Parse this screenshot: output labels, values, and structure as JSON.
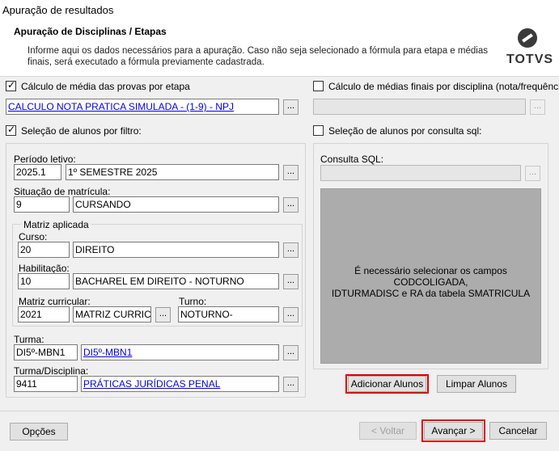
{
  "window": {
    "title": "Apuração de resultados"
  },
  "header": {
    "title": "Apuração de Disciplinas / Etapas",
    "description": "Informe aqui os dados necessários para a apuração. Caso não seja selecionado a fórmula para etapa e médias finais, será executado a fórmula previamente cadastrada.",
    "logo_text": "TOTVS"
  },
  "left": {
    "calc_media_label": "Cálculo de média das provas por etapa",
    "calc_media_checked": true,
    "formula_link": "CALCULO NOTA PRATICA SIMULADA - (1-9) - NPJ",
    "selecao_filtro_label": "Seleção de alunos por filtro:",
    "selecao_filtro_checked": true,
    "periodo_label": "Período letivo:",
    "periodo_code": "2025.1",
    "periodo_desc": "1º SEMESTRE 2025",
    "situacao_label": "Situação de matrícula:",
    "situacao_code": "9",
    "situacao_desc": "CURSANDO",
    "matriz_group_label": "Matriz aplicada",
    "curso_label": "Curso:",
    "curso_code": "20",
    "curso_desc": "DIREITO",
    "habilitacao_label": "Habilitação:",
    "habilitacao_code": "10",
    "habilitacao_desc": "BACHAREL EM DIREITO - NOTURNO",
    "matriz_label": "Matriz curricular:",
    "matriz_code": "2021",
    "matriz_desc": "MATRIZ CURRICUL",
    "turno_label": "Turno:",
    "turno_value": "NOTURNO-",
    "turma_label": "Turma:",
    "turma_code": "DI5º-MBN1",
    "turma_link": "DI5º-MBN1",
    "turma_disc_label": "Turma/Disciplina:",
    "turma_disc_code": "9411",
    "turma_disc_link": "PRÁTICAS JURÍDICAS PENAL",
    "dots": "..."
  },
  "right": {
    "calc_finais_label": "Cálculo de médias finais por disciplina (nota/frequência)",
    "calc_finais_checked": false,
    "selecao_sql_label": "Seleção de alunos por consulta sql:",
    "selecao_sql_checked": false,
    "consulta_label": "Consulta SQL:",
    "grid_message_line1": "É necessário selecionar os campos CODCOLIGADA,",
    "grid_message_line2": "IDTURMADISC e RA da tabela SMATRICULA",
    "adicionar_label": "Adicionar Alunos",
    "limpar_label": "Limpar Alunos"
  },
  "footer": {
    "opcoes_label": "Opções",
    "voltar_label": "< Voltar",
    "avancar_label": "Avançar >",
    "cancelar_label": "Cancelar"
  },
  "colors": {
    "highlight": "#e00000",
    "link": "#0000ee"
  }
}
